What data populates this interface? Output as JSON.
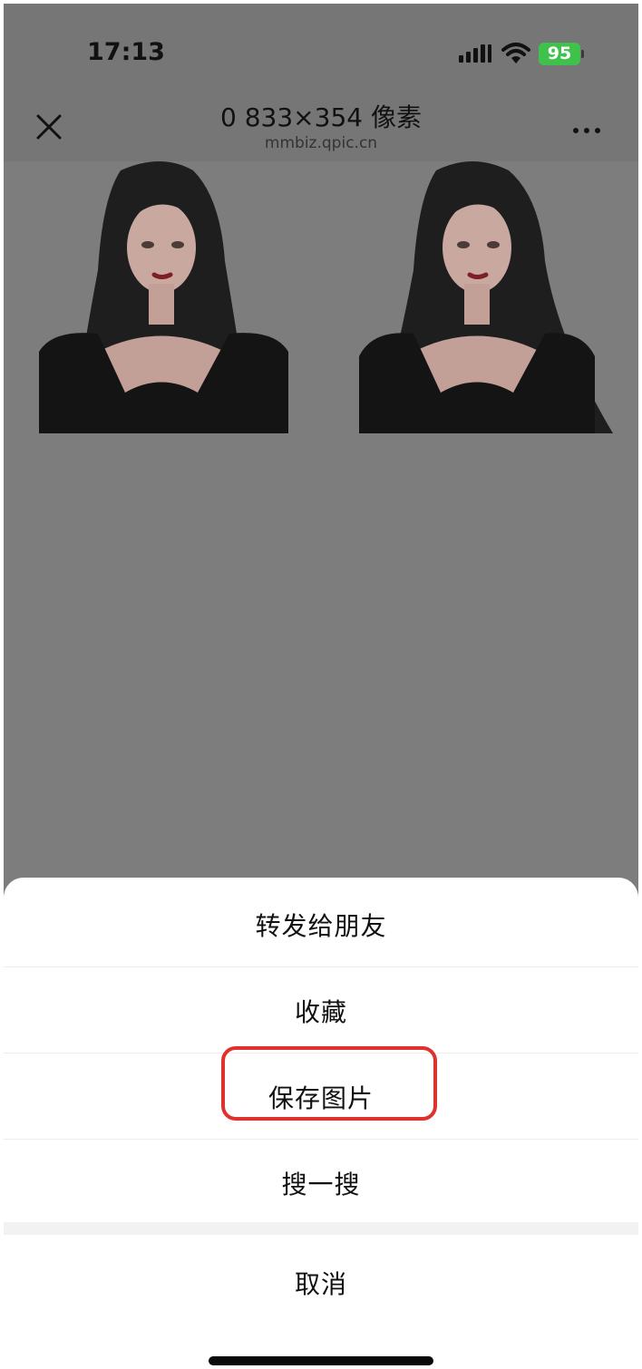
{
  "status_bar": {
    "time": "17:13",
    "battery": "95"
  },
  "header": {
    "title": "0 833×354 像素",
    "subtitle": "mmbiz.qpic.cn",
    "close_icon": "close-icon",
    "more_icon": "more-icon"
  },
  "action_sheet": {
    "items": [
      {
        "label": "转发给朋友"
      },
      {
        "label": "收藏"
      },
      {
        "label": "保存图片"
      },
      {
        "label": "搜一搜"
      }
    ],
    "cancel_label": "取消",
    "highlight_color": "#e0322d"
  }
}
